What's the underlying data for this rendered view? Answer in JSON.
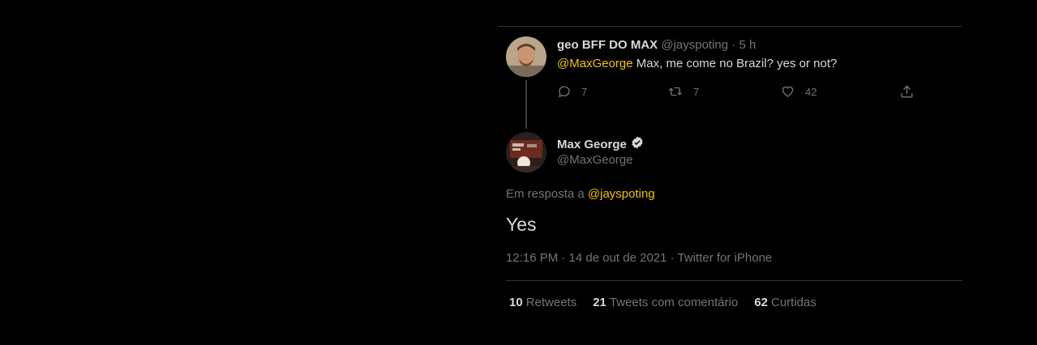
{
  "reply_tweet": {
    "author_name": "geo BFF DO MAX",
    "author_handle": "@jayspoting",
    "time": "5 h",
    "mention": "@MaxGeorge",
    "text": " Max, me come no Brazil? yes or not?",
    "reply_count": "7",
    "retweet_count": "7",
    "like_count": "42"
  },
  "main_tweet": {
    "author_name": "Max George",
    "author_handle": "@MaxGeorge",
    "replying_to_label": "Em resposta a ",
    "replying_to_handle": "@jayspoting",
    "text": "Yes",
    "meta": "12:16 PM · 14 de out de 2021 · Twitter for iPhone"
  },
  "stats": {
    "retweets_count": "10",
    "retweets_label": "Retweets",
    "quotes_count": "21",
    "quotes_label": "Tweets com comentário",
    "likes_count": "62",
    "likes_label": "Curtidas"
  },
  "icons": {
    "reply": "reply-icon",
    "retweet": "retweet-icon",
    "like": "heart-icon",
    "share": "share-icon",
    "verified": "verified-badge-icon"
  },
  "colors": {
    "background": "#000000",
    "text_primary": "#d9d9d9",
    "text_secondary": "#6e767d",
    "mention": "#f0c400",
    "divider": "#2f3336"
  }
}
